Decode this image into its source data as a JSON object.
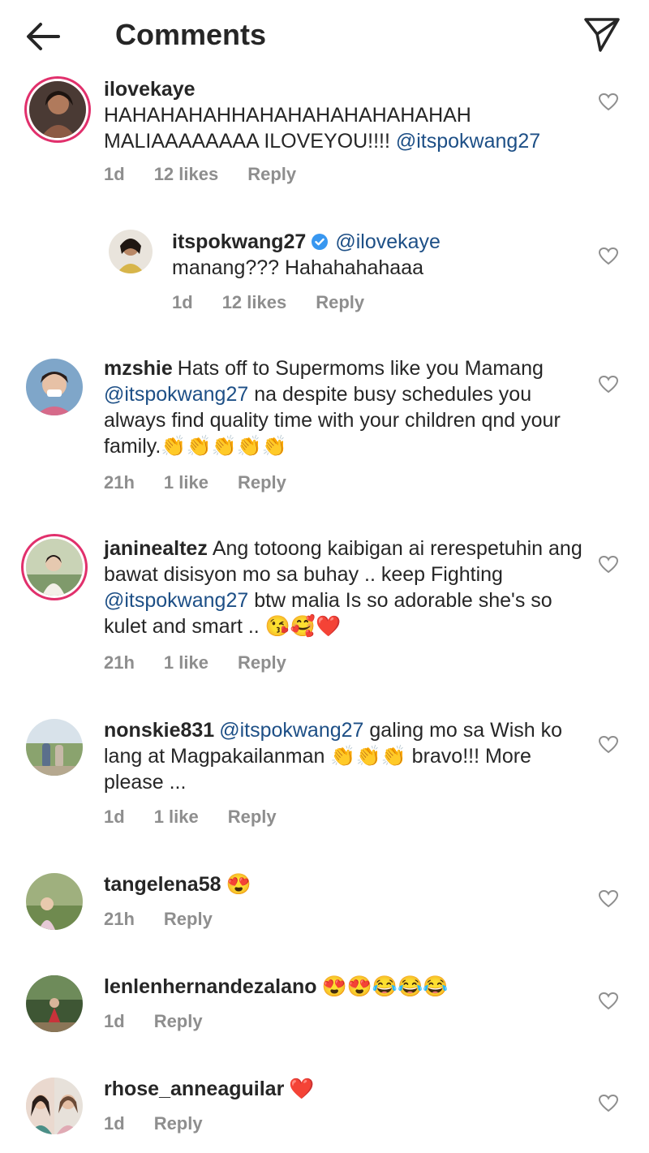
{
  "header": {
    "title": "Comments",
    "back_icon": "arrow-left-icon",
    "share_icon": "paper-plane-icon"
  },
  "comments": [
    {
      "username": "ilovekaye",
      "text_1": "HAHAHAHAHHAHAHAHAHAHAHAHAH MALIAAAAAAAA ILOVEYOU!!!! ",
      "mention": "@itspokwang27",
      "time": "1d",
      "likes": "12 likes",
      "reply_label": "Reply"
    },
    {
      "username": "itspokwang27",
      "verified": true,
      "mention": "@ilovekaye",
      "text_1": "manang??? Hahahahahaaa",
      "time": "1d",
      "likes": "12 likes",
      "reply_label": "Reply"
    },
    {
      "username": "mzshie",
      "text_1": "Hats off to Supermoms like you Mamang ",
      "mention": "@itspokwang27",
      "text_2": "  na despite busy schedules you always find quality time with your children qnd your family.👏👏👏👏👏",
      "time": "21h",
      "likes": "1 like",
      "reply_label": "Reply"
    },
    {
      "username": "janinealtez",
      "text_1": "Ang totoong kaibigan ai rerespetuhin ang bawat disisyon mo sa buhay .. keep Fighting  ",
      "mention": "@itspokwang27",
      "text_2": "  btw malia Is so adorable she's so kulet and smart .. 😘🥰❤️",
      "time": "21h",
      "likes": "1 like",
      "reply_label": "Reply"
    },
    {
      "username": "nonskie831",
      "mention": "@itspokwang27",
      "text_1": " galing mo sa Wish ko lang at Magpakailanman 👏👏👏 bravo!!! More please ...",
      "time": "1d",
      "likes": "1 like",
      "reply_label": "Reply"
    },
    {
      "username": "tangelena58",
      "text_1": "😍",
      "time": "21h",
      "reply_label": "Reply"
    },
    {
      "username": "lenlenhernandezalano",
      "text_1": "😍😍😂😂😂",
      "time": "1d",
      "reply_label": "Reply"
    },
    {
      "username": "rhose_anneaguilar",
      "text_1": "❤️",
      "time": "1d",
      "reply_label": "Reply"
    }
  ],
  "icons": {
    "heart": "heart-outline-icon",
    "verified": "verified-badge-icon"
  }
}
